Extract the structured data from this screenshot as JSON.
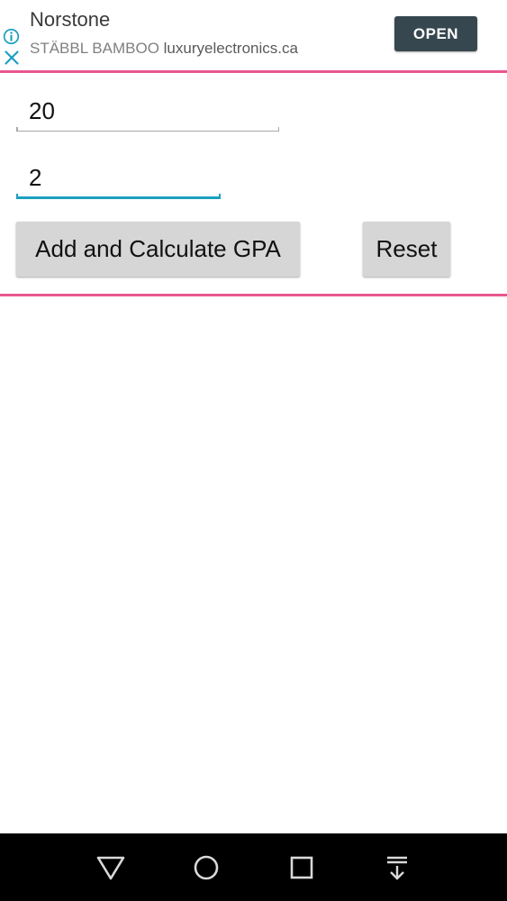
{
  "ad": {
    "title": "Norstone",
    "sponsor": "STÄBBL BAMBOO",
    "domain": "luxuryelectronics.ca",
    "open_label": "OPEN",
    "info_icon": "info-icon",
    "close_icon": "close-icon",
    "accent_color": "#e8578f",
    "button_color": "#37474f"
  },
  "form": {
    "field_1_value": "20",
    "field_2_value": "2",
    "calculate_label": "Add and Calculate GPA",
    "reset_label": "Reset",
    "focus_color": "#1ba0c0"
  },
  "nav": {
    "back_icon": "back-icon",
    "home_icon": "home-icon",
    "recents_icon": "recents-icon",
    "pull_down_icon": "pull-down-icon"
  }
}
